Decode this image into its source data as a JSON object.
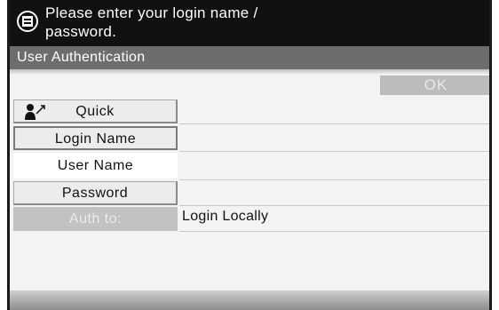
{
  "message": {
    "text": "Please enter your login name /\npassword.",
    "icon": "copier-icon"
  },
  "title": "User Authentication",
  "ok_label": "OK",
  "fields": {
    "quick_label": "Quick",
    "quick_icon": "user-quick-icon",
    "login_name_label": "Login Name",
    "user_name_label": "User Name",
    "password_label": "Password",
    "auth_to_label": "Auth to:",
    "auth_to_value": "Login Locally"
  }
}
